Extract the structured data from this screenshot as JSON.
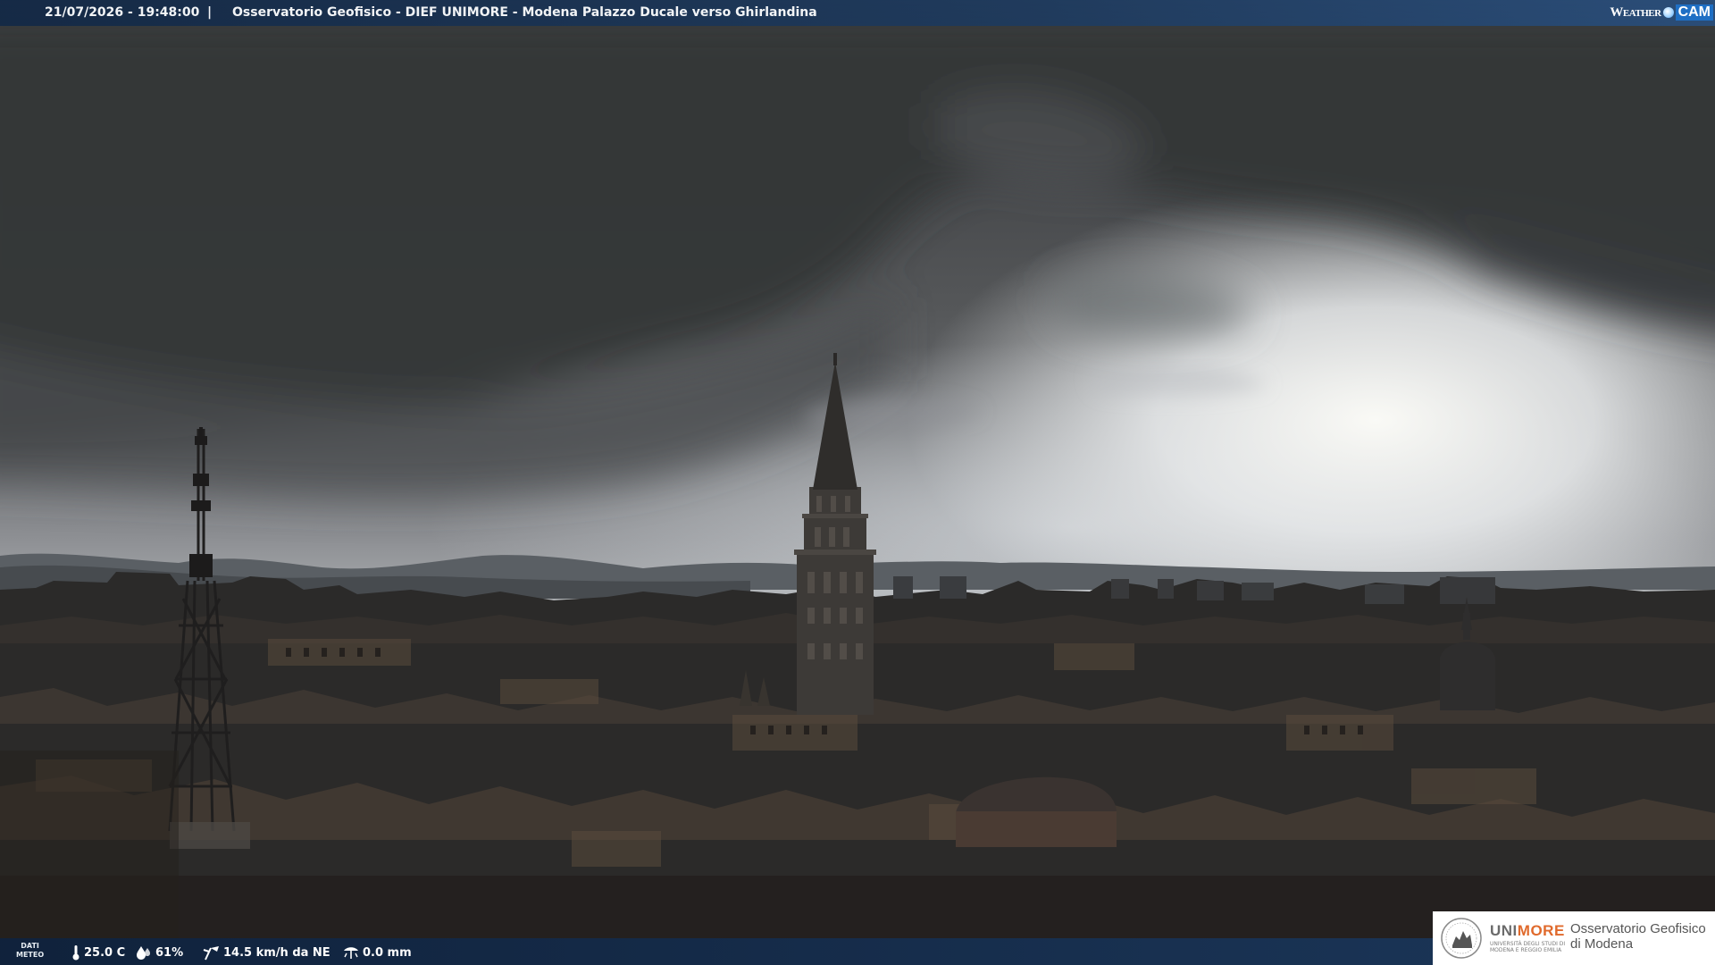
{
  "overlay": {
    "timestamp": "21/07/2026 - 19:48:00",
    "separator": "|",
    "camera_title": "Osservatorio Geofisico - DIEF UNIMORE - Modena Palazzo Ducale verso Ghirlandina",
    "weathercam_logo": {
      "word": "Weather",
      "badge": "CAM"
    }
  },
  "weather": {
    "label_line1": "DATI",
    "label_line2": "METEO",
    "temperature": "25.0 C",
    "humidity": "61%",
    "wind": "14.5 km/h da NE",
    "rain": "0.0 mm",
    "icons": [
      "thermometer-icon",
      "drop-icon",
      "wind-icon",
      "rain-gauge-icon"
    ]
  },
  "institution": {
    "uni_prefix": "UNI",
    "uni_suffix": "MORE",
    "uni_subtitle": "UNIVERSITÀ DEGLI STUDI DI MODENA E REGGIO EMILIA",
    "observatory_line1": "Osservatorio Geofisico",
    "observatory_line2": "di Modena",
    "accent_color": "#e06a2c"
  },
  "colors": {
    "bar_dark": "#12284a",
    "bar_light": "#28508a"
  }
}
